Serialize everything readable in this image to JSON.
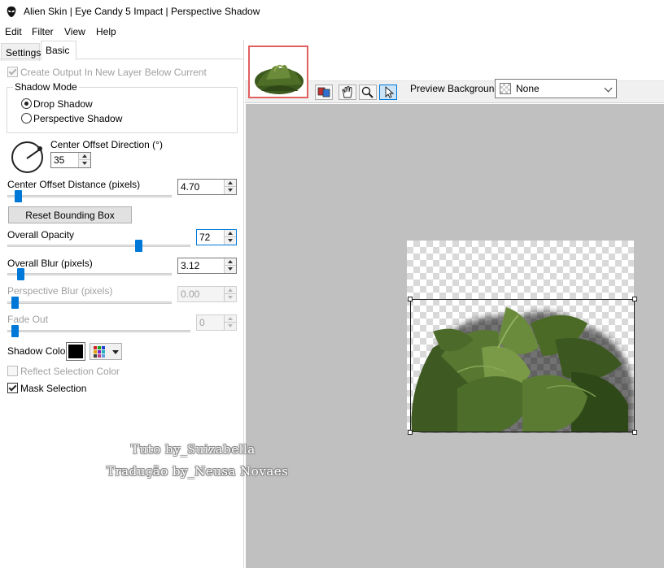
{
  "window": {
    "title": "Alien Skin | Eye Candy 5 Impact | Perspective Shadow"
  },
  "menu": [
    "Edit",
    "Filter",
    "View",
    "Help"
  ],
  "tabs": {
    "settings": "Settings",
    "basic": "Basic"
  },
  "basic": {
    "create_output_label": "Create Output In New Layer Below Current",
    "create_output_checked": true,
    "shadow_mode": {
      "label": "Shadow Mode",
      "options": [
        "Drop Shadow",
        "Perspective Shadow"
      ],
      "selected": "Drop Shadow"
    },
    "center_offset_direction": {
      "label": "Center Offset Direction (°)",
      "value": "35"
    },
    "center_offset_distance": {
      "label": "Center Offset Distance (pixels)",
      "value": "4.70"
    },
    "reset_bounding_box": "Reset Bounding Box",
    "overall_opacity": {
      "label": "Overall Opacity",
      "value": "72"
    },
    "overall_blur": {
      "label": "Overall Blur (pixels)",
      "value": "3.12"
    },
    "perspective_blur": {
      "label": "Perspective Blur (pixels)",
      "value": "0.00"
    },
    "fade_out": {
      "label": "Fade Out",
      "value": "0"
    },
    "shadow_color": {
      "label": "Shadow Color",
      "color": "#000000"
    },
    "reflect_selection_color": {
      "label": "Reflect Selection Color",
      "checked": false
    },
    "mask_selection": {
      "label": "Mask Selection",
      "checked": true
    }
  },
  "watermark": {
    "line1": "Tuto by_Suizabella",
    "line2": "Tradução by_Neusa Novaes"
  },
  "toolbar": {
    "tools": [
      "before-after-icon",
      "hand-icon",
      "zoom-icon",
      "pointer-icon"
    ],
    "preview_background_label": "Preview Background:",
    "preview_background_value": "None"
  },
  "colors": {
    "accent": "#0078d7",
    "preview_bg": "#c0c0c0",
    "thumbnail_border": "#e06060"
  }
}
